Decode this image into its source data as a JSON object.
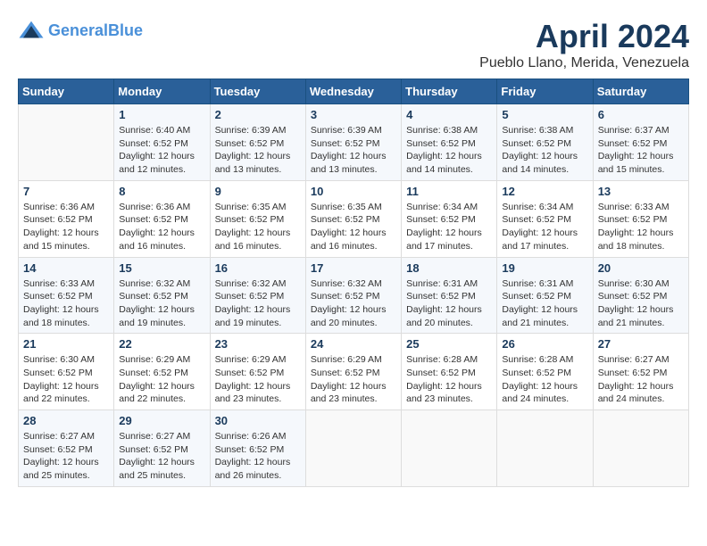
{
  "header": {
    "logo_line1": "General",
    "logo_line2": "Blue",
    "title": "April 2024",
    "subtitle": "Pueblo Llano, Merida, Venezuela"
  },
  "days_of_week": [
    "Sunday",
    "Monday",
    "Tuesday",
    "Wednesday",
    "Thursday",
    "Friday",
    "Saturday"
  ],
  "weeks": [
    [
      {
        "day": "",
        "info": ""
      },
      {
        "day": "1",
        "info": "Sunrise: 6:40 AM\nSunset: 6:52 PM\nDaylight: 12 hours\nand 12 minutes."
      },
      {
        "day": "2",
        "info": "Sunrise: 6:39 AM\nSunset: 6:52 PM\nDaylight: 12 hours\nand 13 minutes."
      },
      {
        "day": "3",
        "info": "Sunrise: 6:39 AM\nSunset: 6:52 PM\nDaylight: 12 hours\nand 13 minutes."
      },
      {
        "day": "4",
        "info": "Sunrise: 6:38 AM\nSunset: 6:52 PM\nDaylight: 12 hours\nand 14 minutes."
      },
      {
        "day": "5",
        "info": "Sunrise: 6:38 AM\nSunset: 6:52 PM\nDaylight: 12 hours\nand 14 minutes."
      },
      {
        "day": "6",
        "info": "Sunrise: 6:37 AM\nSunset: 6:52 PM\nDaylight: 12 hours\nand 15 minutes."
      }
    ],
    [
      {
        "day": "7",
        "info": "Sunrise: 6:36 AM\nSunset: 6:52 PM\nDaylight: 12 hours\nand 15 minutes."
      },
      {
        "day": "8",
        "info": "Sunrise: 6:36 AM\nSunset: 6:52 PM\nDaylight: 12 hours\nand 16 minutes."
      },
      {
        "day": "9",
        "info": "Sunrise: 6:35 AM\nSunset: 6:52 PM\nDaylight: 12 hours\nand 16 minutes."
      },
      {
        "day": "10",
        "info": "Sunrise: 6:35 AM\nSunset: 6:52 PM\nDaylight: 12 hours\nand 16 minutes."
      },
      {
        "day": "11",
        "info": "Sunrise: 6:34 AM\nSunset: 6:52 PM\nDaylight: 12 hours\nand 17 minutes."
      },
      {
        "day": "12",
        "info": "Sunrise: 6:34 AM\nSunset: 6:52 PM\nDaylight: 12 hours\nand 17 minutes."
      },
      {
        "day": "13",
        "info": "Sunrise: 6:33 AM\nSunset: 6:52 PM\nDaylight: 12 hours\nand 18 minutes."
      }
    ],
    [
      {
        "day": "14",
        "info": "Sunrise: 6:33 AM\nSunset: 6:52 PM\nDaylight: 12 hours\nand 18 minutes."
      },
      {
        "day": "15",
        "info": "Sunrise: 6:32 AM\nSunset: 6:52 PM\nDaylight: 12 hours\nand 19 minutes."
      },
      {
        "day": "16",
        "info": "Sunrise: 6:32 AM\nSunset: 6:52 PM\nDaylight: 12 hours\nand 19 minutes."
      },
      {
        "day": "17",
        "info": "Sunrise: 6:32 AM\nSunset: 6:52 PM\nDaylight: 12 hours\nand 20 minutes."
      },
      {
        "day": "18",
        "info": "Sunrise: 6:31 AM\nSunset: 6:52 PM\nDaylight: 12 hours\nand 20 minutes."
      },
      {
        "day": "19",
        "info": "Sunrise: 6:31 AM\nSunset: 6:52 PM\nDaylight: 12 hours\nand 21 minutes."
      },
      {
        "day": "20",
        "info": "Sunrise: 6:30 AM\nSunset: 6:52 PM\nDaylight: 12 hours\nand 21 minutes."
      }
    ],
    [
      {
        "day": "21",
        "info": "Sunrise: 6:30 AM\nSunset: 6:52 PM\nDaylight: 12 hours\nand 22 minutes."
      },
      {
        "day": "22",
        "info": "Sunrise: 6:29 AM\nSunset: 6:52 PM\nDaylight: 12 hours\nand 22 minutes."
      },
      {
        "day": "23",
        "info": "Sunrise: 6:29 AM\nSunset: 6:52 PM\nDaylight: 12 hours\nand 23 minutes."
      },
      {
        "day": "24",
        "info": "Sunrise: 6:29 AM\nSunset: 6:52 PM\nDaylight: 12 hours\nand 23 minutes."
      },
      {
        "day": "25",
        "info": "Sunrise: 6:28 AM\nSunset: 6:52 PM\nDaylight: 12 hours\nand 23 minutes."
      },
      {
        "day": "26",
        "info": "Sunrise: 6:28 AM\nSunset: 6:52 PM\nDaylight: 12 hours\nand 24 minutes."
      },
      {
        "day": "27",
        "info": "Sunrise: 6:27 AM\nSunset: 6:52 PM\nDaylight: 12 hours\nand 24 minutes."
      }
    ],
    [
      {
        "day": "28",
        "info": "Sunrise: 6:27 AM\nSunset: 6:52 PM\nDaylight: 12 hours\nand 25 minutes."
      },
      {
        "day": "29",
        "info": "Sunrise: 6:27 AM\nSunset: 6:52 PM\nDaylight: 12 hours\nand 25 minutes."
      },
      {
        "day": "30",
        "info": "Sunrise: 6:26 AM\nSunset: 6:52 PM\nDaylight: 12 hours\nand 26 minutes."
      },
      {
        "day": "",
        "info": ""
      },
      {
        "day": "",
        "info": ""
      },
      {
        "day": "",
        "info": ""
      },
      {
        "day": "",
        "info": ""
      }
    ]
  ]
}
